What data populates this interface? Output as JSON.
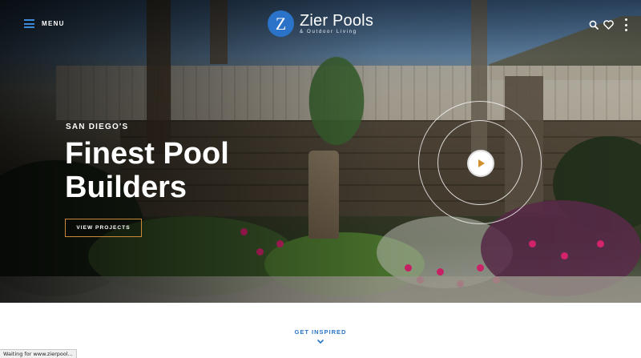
{
  "header": {
    "menu_label": "MENU",
    "logo_letter": "Z",
    "brand_name": "Zier Pools",
    "brand_tagline": "& Outdoor Living",
    "icons": [
      "menu-icon",
      "search-icon",
      "heart-icon",
      "more-icon"
    ],
    "accent_color": "#2a73c8"
  },
  "hero": {
    "eyebrow": "SAN DIEGO'S",
    "headline_line1": "Finest Pool",
    "headline_line2": "Builders",
    "cta_label": "VIEW PROJECTS",
    "cta_border_color": "#c98a3a",
    "play_icon": "play-icon"
  },
  "section": {
    "get_inspired_label": "GET INSPIRED"
  },
  "browser": {
    "status_text": "Waiting for www.zierpool..."
  }
}
